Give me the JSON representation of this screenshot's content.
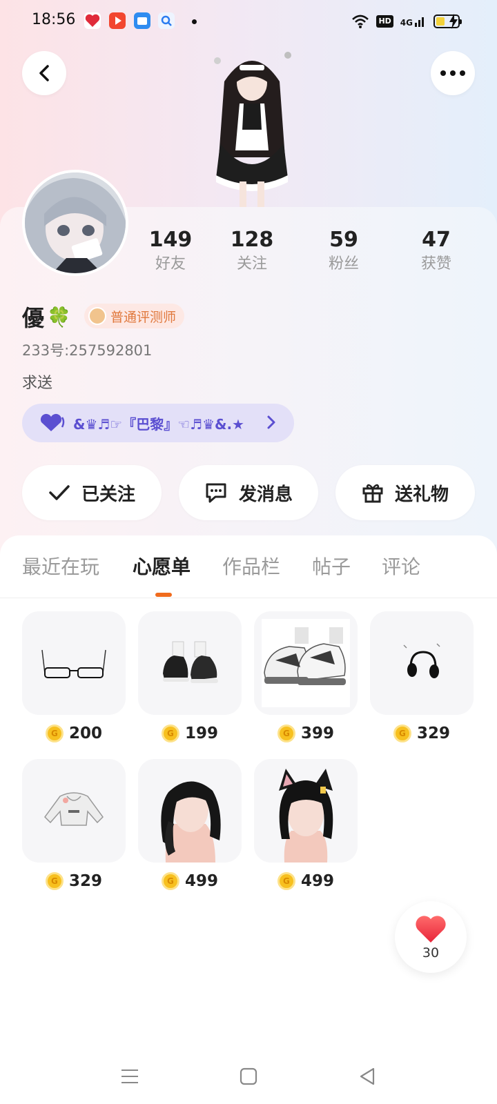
{
  "status_bar": {
    "time": "18:56",
    "hd": "HD",
    "network": "4G",
    "battery_level": 0.35,
    "app_icons": [
      "app-icon-red-heart",
      "app-icon-video-play",
      "app-icon-blue-box",
      "app-icon-search"
    ]
  },
  "header": {
    "back_icon": "chevron-left-icon",
    "more_icon": "more-dots-icon"
  },
  "profile": {
    "stats": [
      {
        "num": "149",
        "label": "好友"
      },
      {
        "num": "128",
        "label": "关注"
      },
      {
        "num": "59",
        "label": "粉丝"
      },
      {
        "num": "47",
        "label": "获赞"
      }
    ],
    "name": "優",
    "name_emoji": "🍀",
    "level": "普通评测师",
    "uid": "233号:257592801",
    "bio": "求送",
    "group_text": "&♛♬☞『巴黎』☜♬♛&.★"
  },
  "actions": [
    {
      "label": "已关注",
      "icon": "check-icon"
    },
    {
      "label": "发消息",
      "icon": "message-icon"
    },
    {
      "label": "送礼物",
      "icon": "gift-icon"
    }
  ],
  "tabs": [
    {
      "label": "最近在玩",
      "active": false
    },
    {
      "label": "心愿单",
      "active": true
    },
    {
      "label": "作品栏",
      "active": false
    },
    {
      "label": "帖子",
      "active": false
    },
    {
      "label": "评论",
      "active": false
    }
  ],
  "wishlist": [
    {
      "name": "glasses-item",
      "price": "200"
    },
    {
      "name": "sneakers-black-item",
      "price": "199"
    },
    {
      "name": "sneakers-white-item",
      "price": "399"
    },
    {
      "name": "headphones-item",
      "price": "329"
    },
    {
      "name": "cropped-hoodie-item",
      "price": "329"
    },
    {
      "name": "black-hair-item",
      "price": "499"
    },
    {
      "name": "cat-ear-hair-item",
      "price": "499"
    }
  ],
  "like_fab": {
    "count": "30"
  },
  "colors": {
    "accent": "#f06b1d",
    "group_purple": "#5b4fd1",
    "coin_gold": "#f7c01f",
    "like_red": "#f0404a"
  }
}
